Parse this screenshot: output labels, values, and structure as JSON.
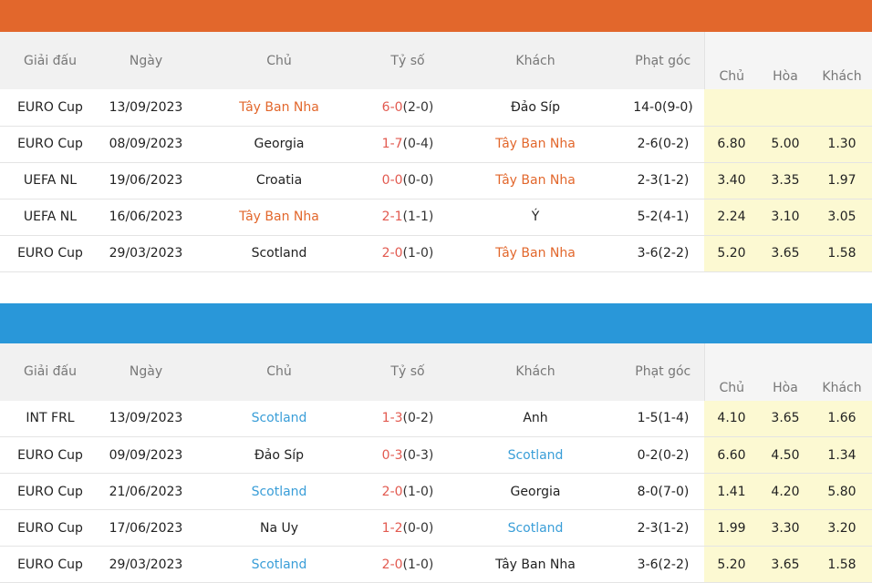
{
  "colors": {
    "orange": "#e2672c",
    "blue": "#2997d9",
    "odds_bg": "#fcf9d2",
    "score_red": "#e25a50"
  },
  "headers": {
    "league": "Giải đấu",
    "date": "Ngày",
    "home": "Chủ",
    "score": "Tỷ số",
    "away": "Khách",
    "corners": "Phạt góc",
    "odds_home": "Chủ",
    "odds_draw": "Hòa",
    "odds_away": "Khách"
  },
  "table1": {
    "rows": [
      {
        "league": "EURO Cup",
        "date": "13/09/2023",
        "home": "Tây Ban Nha",
        "score": "6-0",
        "ht": "(2-0)",
        "away": "Đảo Síp",
        "corners": "14-0(9-0)",
        "o1": "",
        "o2": "",
        "o3": "",
        "hl": "home"
      },
      {
        "league": "EURO Cup",
        "date": "08/09/2023",
        "home": "Georgia",
        "score": "1-7",
        "ht": "(0-4)",
        "away": "Tây Ban Nha",
        "corners": "2-6(0-2)",
        "o1": "6.80",
        "o2": "5.00",
        "o3": "1.30",
        "hl": "away"
      },
      {
        "league": "UEFA NL",
        "date": "19/06/2023",
        "home": "Croatia",
        "score": "0-0",
        "ht": "(0-0)",
        "away": "Tây Ban Nha",
        "corners": "2-3(1-2)",
        "o1": "3.40",
        "o2": "3.35",
        "o3": "1.97",
        "hl": "away"
      },
      {
        "league": "UEFA NL",
        "date": "16/06/2023",
        "home": "Tây Ban Nha",
        "score": "2-1",
        "ht": "(1-1)",
        "away": "Ý",
        "corners": "5-2(4-1)",
        "o1": "2.24",
        "o2": "3.10",
        "o3": "3.05",
        "hl": "home"
      },
      {
        "league": "EURO Cup",
        "date": "29/03/2023",
        "home": "Scotland",
        "score": "2-0",
        "ht": "(1-0)",
        "away": "Tây Ban Nha",
        "corners": "3-6(2-2)",
        "o1": "5.20",
        "o2": "3.65",
        "o3": "1.58",
        "hl": "away"
      }
    ]
  },
  "table2": {
    "rows": [
      {
        "league": "INT FRL",
        "date": "13/09/2023",
        "home": "Scotland",
        "score": "1-3",
        "ht": "(0-2)",
        "away": "Anh",
        "corners": "1-5(1-4)",
        "o1": "4.10",
        "o2": "3.65",
        "o3": "1.66",
        "hl": "home"
      },
      {
        "league": "EURO Cup",
        "date": "09/09/2023",
        "home": "Đảo Síp",
        "score": "0-3",
        "ht": "(0-3)",
        "away": "Scotland",
        "corners": "0-2(0-2)",
        "o1": "6.60",
        "o2": "4.50",
        "o3": "1.34",
        "hl": "away"
      },
      {
        "league": "EURO Cup",
        "date": "21/06/2023",
        "home": "Scotland",
        "score": "2-0",
        "ht": "(1-0)",
        "away": "Georgia",
        "corners": "8-0(7-0)",
        "o1": "1.41",
        "o2": "4.20",
        "o3": "5.80",
        "hl": "home"
      },
      {
        "league": "EURO Cup",
        "date": "17/06/2023",
        "home": "Na Uy",
        "score": "1-2",
        "ht": "(0-0)",
        "away": "Scotland",
        "corners": "2-3(1-2)",
        "o1": "1.99",
        "o2": "3.30",
        "o3": "3.20",
        "hl": "away"
      },
      {
        "league": "EURO Cup",
        "date": "29/03/2023",
        "home": "Scotland",
        "score": "2-0",
        "ht": "(1-0)",
        "away": "Tây Ban Nha",
        "corners": "3-6(2-2)",
        "o1": "5.20",
        "o2": "3.65",
        "o3": "1.58",
        "hl": "home"
      }
    ]
  }
}
